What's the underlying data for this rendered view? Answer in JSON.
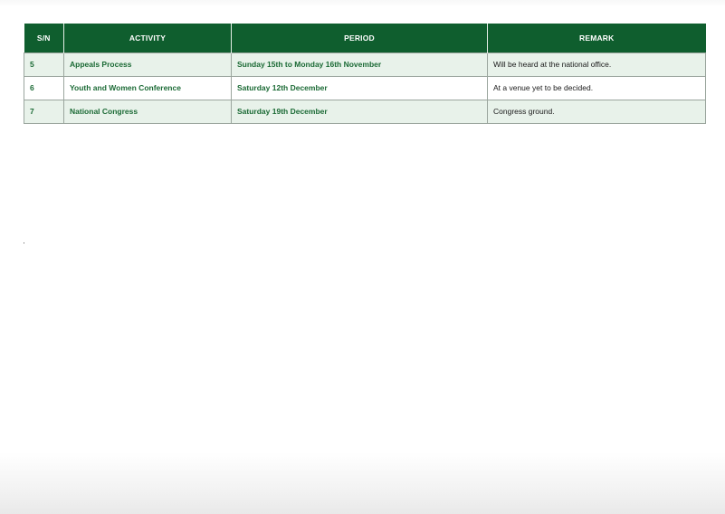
{
  "table": {
    "headers": [
      "S/N",
      "ACTIVITY",
      "PERIOD",
      "REMARK"
    ],
    "rows": [
      {
        "sn": "5",
        "activity": "Appeals Process",
        "period": "Sunday 15th to Monday 16th November",
        "remark": "Will be heard at the national office."
      },
      {
        "sn": "6",
        "activity": "Youth and Women Conference",
        "period": "Saturday 12th December",
        "remark": "At a venue yet to be decided."
      },
      {
        "sn": "7",
        "activity": "National Congress",
        "period": "Saturday 19th December",
        "remark": "Congress ground."
      }
    ]
  },
  "colors": {
    "header_bg": "#0f5e2e",
    "header_text": "#ffffff",
    "accent_text": "#1b6a35",
    "shaded_row": "#e8f2ea"
  }
}
